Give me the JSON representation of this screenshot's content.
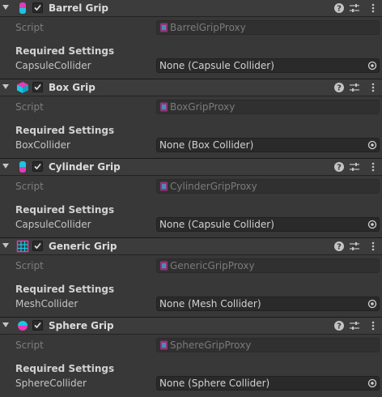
{
  "components": [
    {
      "id": "barrel",
      "title": "Barrel Grip",
      "icon": "barrel-grip-icon",
      "script_label": "Script",
      "script_value": "BarrelGripProxy",
      "section_label": "Required Settings",
      "collider_label": "CapsuleCollider",
      "collider_value": "None (Capsule Collider)"
    },
    {
      "id": "box",
      "title": "Box Grip",
      "icon": "box-grip-icon",
      "script_label": "Script",
      "script_value": "BoxGripProxy",
      "section_label": "Required Settings",
      "collider_label": "BoxCollider",
      "collider_value": "None (Box Collider)"
    },
    {
      "id": "cylinder",
      "title": "Cylinder Grip",
      "icon": "cylinder-grip-icon",
      "script_label": "Script",
      "script_value": "CylinderGripProxy",
      "section_label": "Required Settings",
      "collider_label": "CapsuleCollider",
      "collider_value": "None (Capsule Collider)"
    },
    {
      "id": "generic",
      "title": "Generic Grip",
      "icon": "generic-grip-icon",
      "script_label": "Script",
      "script_value": "GenericGripProxy",
      "section_label": "Required Settings",
      "collider_label": "MeshCollider",
      "collider_value": "None (Mesh Collider)"
    },
    {
      "id": "sphere",
      "title": "Sphere Grip",
      "icon": "sphere-grip-icon",
      "script_label": "Script",
      "script_value": "SphereGripProxy",
      "section_label": "Required Settings",
      "collider_label": "SphereCollider",
      "collider_value": "None (Sphere Collider)"
    }
  ],
  "colors": {
    "cyan": "#19c6e6",
    "magenta": "#e43bb4",
    "background": "#383838",
    "header": "#3c3c3c"
  }
}
